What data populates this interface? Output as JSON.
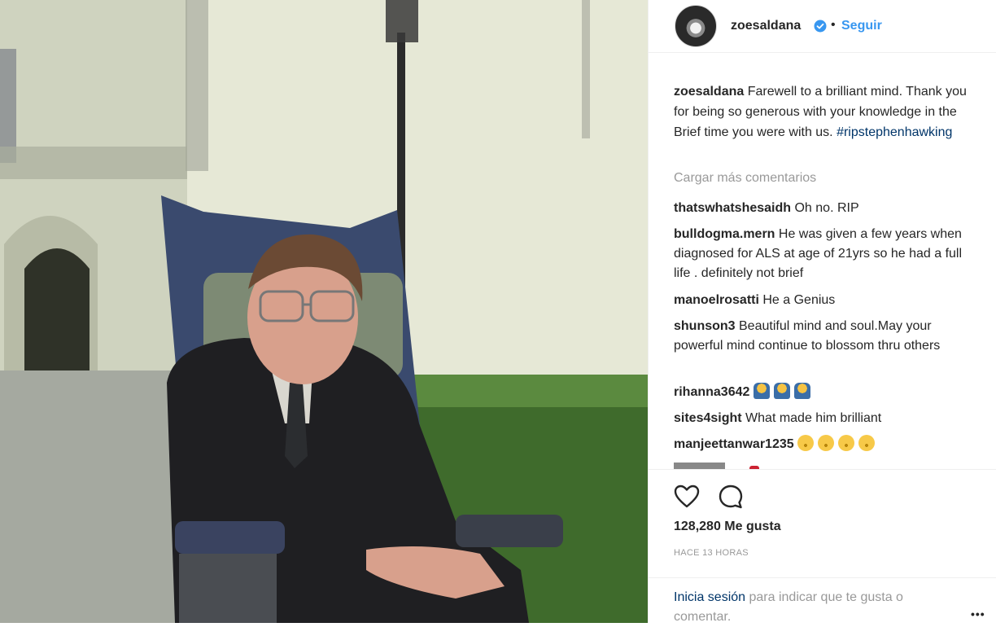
{
  "post": {
    "image_alt": "Stephen Hawking seated in a wheelchair outdoors"
  },
  "header": {
    "username": "zoesaldana",
    "separator": "•",
    "follow_label": "Seguir"
  },
  "caption": {
    "username": "zoesaldana",
    "text": " Farewell to a brilliant mind. Thank you for being so generous with your knowledge in the Brief time you were with us. ",
    "hashtag": "#ripstephenhawking"
  },
  "load_more_label": "Cargar más comentarios",
  "comments": [
    {
      "user": "thatswhatshesaidh",
      "text": " Oh no. RIP"
    },
    {
      "user": "bulldogma.mern",
      "text": " He was given a few years when diagnosed for ALS at age of 21yrs so he had a full life . definitely not brief"
    },
    {
      "user": "manoelrosatti",
      "text": " He a Genius"
    },
    {
      "user": "shunson3",
      "text": " Beautiful mind and soul.May your powerful mind continue to blossom thru others"
    },
    {
      "user": "rihanna3642",
      "text": " ",
      "emoji": "pray",
      "emoji_count": 3
    },
    {
      "user": "sites4sight",
      "text": " What made him brilliant"
    },
    {
      "user": "manjeettanwar1235",
      "text": " ",
      "emoji": "tired-face",
      "emoji_count": 4
    }
  ],
  "likes_label": "128,280 Me gusta",
  "timestamp": "HACE 13 HORAS",
  "login_prompt": {
    "link": "Inicia sesión",
    "rest": " para indicar que te gusta o comentar."
  },
  "more_label": "•••",
  "colors": {
    "link_blue": "#3897f0",
    "hashtag": "#003569",
    "muted": "#999999",
    "text": "#262626"
  }
}
